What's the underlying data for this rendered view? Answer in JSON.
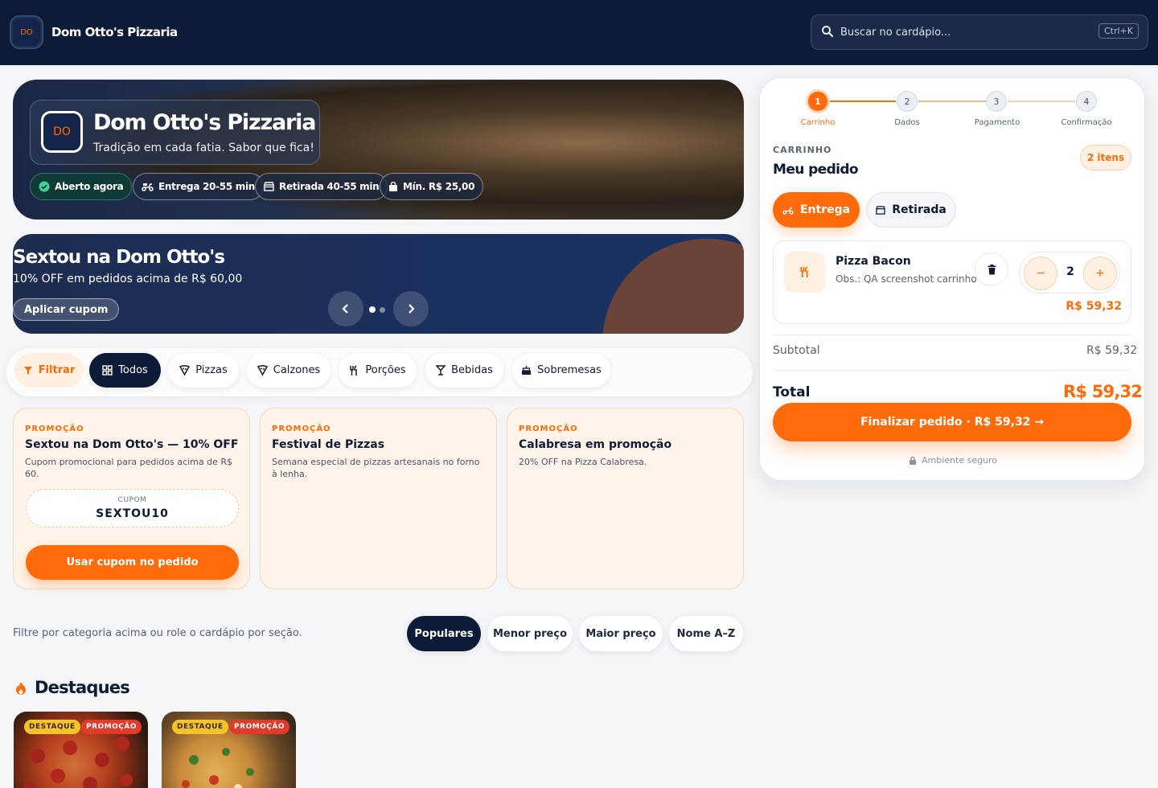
{
  "header": {
    "logo": "DO",
    "brand": "Dom Otto's Pizzaria",
    "search_placeholder": "Buscar no cardápio...",
    "search_shortcut": "Ctrl+K"
  },
  "hero": {
    "logo": "DO",
    "title": "Dom Otto's Pizzaria",
    "subtitle": "Tradição em cada fatia. Sabor que fica!",
    "chips": {
      "open": "Aberto agora",
      "delivery": "Entrega 20-55 min",
      "pickup": "Retirada 40-55 min",
      "minimum": "Mín. R$ 25,00"
    }
  },
  "banner": {
    "title": "Sextou na Dom Otto's",
    "subtitle": "10% OFF em pedidos acima de R$ 60,00",
    "button": "Aplicar cupom"
  },
  "filters": {
    "filter_label": "Filtrar",
    "categories": [
      "Todos",
      "Pizzas",
      "Calzones",
      "Porções",
      "Bebidas",
      "Sobremesas"
    ],
    "active": "Todos"
  },
  "promos": [
    {
      "tag": "PROMOÇÃO",
      "title": "Sextou na Dom Otto's — 10% OFF",
      "desc": "Cupom promocional para pedidos acima de R$ 60.",
      "coupon_label": "CUPOM",
      "coupon_code": "SEXTOU10",
      "button": "Usar cupom no pedido"
    },
    {
      "tag": "PROMOÇÃO",
      "title": "Festival de Pizzas",
      "desc": "Semana especial de pizzas artesanais no forno à lenha."
    },
    {
      "tag": "PROMOÇÃO",
      "title": "Calabresa em promoção",
      "desc": "20% OFF na Pizza Calabresa."
    }
  ],
  "sort": {
    "hint": "Filtre por categoria acima ou role o cardápio por seção.",
    "options": [
      "Populares",
      "Menor preço",
      "Maior preço",
      "Nome A–Z"
    ],
    "active": "Populares"
  },
  "highlights": {
    "title": "Destaques",
    "cards": [
      {
        "badge1": "DESTAQUE",
        "badge2": "PROMOÇÃO"
      },
      {
        "badge1": "DESTAQUE",
        "badge2": "PROMOÇÃO"
      }
    ]
  },
  "cart": {
    "steps": [
      "Carrinho",
      "Dados",
      "Pagamento",
      "Confirmação"
    ],
    "step_numbers": [
      "1",
      "2",
      "3",
      "4"
    ],
    "kicker": "CARRINHO",
    "title": "Meu pedido",
    "items_badge": "2 itens",
    "mode_delivery": "Entrega",
    "mode_pickup": "Retirada",
    "item": {
      "name": "Pizza Bacon",
      "note": "Obs.: QA screenshot carrinho",
      "qty": "2",
      "price": "R$ 59,32",
      "minus": "−",
      "plus": "+"
    },
    "subtotal_label": "Subtotal",
    "subtotal": "R$ 59,32",
    "total_label": "Total",
    "total": "R$ 59,32",
    "checkout": "Finalizar pedido · R$ 59,32 →",
    "secure": "Ambiente seguro"
  },
  "colors": {
    "accent": "#ff6b0a",
    "navy": "#0d1b36"
  }
}
